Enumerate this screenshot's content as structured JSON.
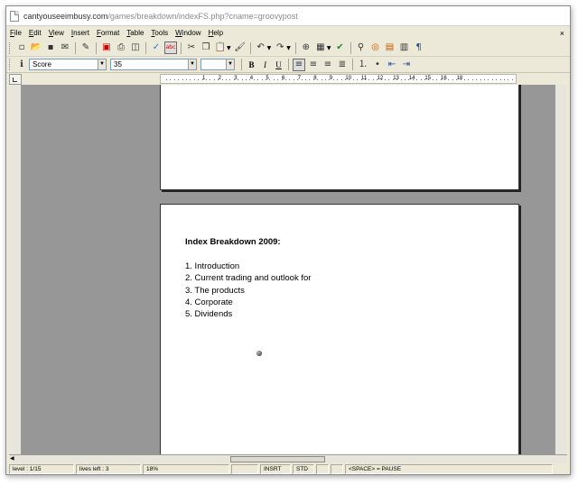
{
  "browser": {
    "url_host": "cantyouseeimbusy.com",
    "url_path": "/games/breakdown/indexFS.php?cname=groovypost"
  },
  "menubar": {
    "items": [
      {
        "label": "File",
        "key": "F",
        "rest": "ile"
      },
      {
        "label": "Edit",
        "key": "E",
        "rest": "dit"
      },
      {
        "label": "View",
        "key": "V",
        "rest": "iew"
      },
      {
        "label": "Insert",
        "key": "I",
        "rest": "nsert"
      },
      {
        "label": "Format",
        "key": "F",
        "rest": "ormat",
        "key_pos": "start"
      },
      {
        "label": "Table",
        "key": "T",
        "rest": "able"
      },
      {
        "label": "Tools",
        "key": "T",
        "rest": "ools"
      },
      {
        "label": "Window",
        "key": "W",
        "rest": "indow"
      },
      {
        "label": "Help",
        "key": "H",
        "rest": "elp"
      }
    ],
    "close_glyph": "×"
  },
  "formatting": {
    "style_value": "Score",
    "font_value": "35",
    "size_value": "",
    "bold": "B",
    "italic": "I",
    "underline": "U"
  },
  "ruler": {
    "labels": [
      "1",
      "2",
      "3",
      "4",
      "5",
      "6",
      "7",
      "8",
      "9",
      "10",
      "11",
      "12",
      "13",
      "14",
      "15",
      "16",
      "18"
    ]
  },
  "document": {
    "heading": "Index Breakdown 2009:",
    "items": [
      "1. Introduction",
      "2. Current trading and outlook for",
      "3. The products",
      "4. Corporate",
      "5. Dividends"
    ]
  },
  "statusbar": {
    "level": "level : 1/15",
    "lives": "lives left : 3",
    "zoom": "18%",
    "mode": "INSRT",
    "std": "STD",
    "hint": "<SPACE> = PAUSE"
  },
  "colors": {
    "doc_background": "#979797",
    "chrome": "#ece9d8"
  }
}
